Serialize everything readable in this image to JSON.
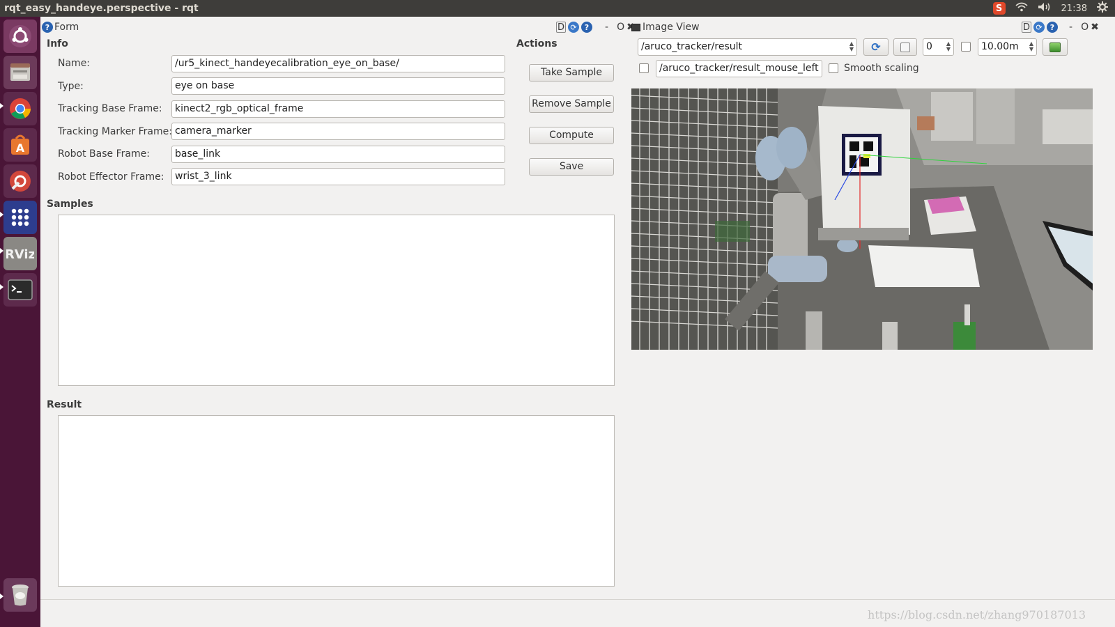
{
  "window": {
    "title": "rqt_easy_handeye.perspective - rqt"
  },
  "tray": {
    "ime_label": "S",
    "clock": "21:38"
  },
  "launcher": {
    "items": [
      "ubuntu-dash",
      "files",
      "chrome",
      "software-center",
      "system-settings",
      "app-grid",
      "rviz",
      "terminal",
      "trash"
    ]
  },
  "form_panel": {
    "title": "Form",
    "info_heading": "Info",
    "actions_heading": "Actions",
    "fields": [
      {
        "label": "Name:",
        "value": "/ur5_kinect_handeyecalibration_eye_on_base/"
      },
      {
        "label": "Type:",
        "value": "eye on base"
      },
      {
        "label": "Tracking Base Frame:",
        "value": "kinect2_rgb_optical_frame"
      },
      {
        "label": "Tracking Marker Frame:",
        "value": "camera_marker"
      },
      {
        "label": "Robot Base Frame:",
        "value": "base_link"
      },
      {
        "label": "Robot Effector Frame:",
        "value": "wrist_3_link"
      }
    ],
    "buttons": {
      "take_sample": "Take Sample",
      "remove_sample": "Remove Sample",
      "compute": "Compute",
      "save": "Save"
    },
    "samples_heading": "Samples",
    "result_heading": "Result"
  },
  "dock_tools": {
    "d": "D",
    "minimize": "-",
    "restore": "O",
    "close": "✖"
  },
  "image_view": {
    "title": "Image View",
    "topic": "/aruco_tracker/result",
    "spin_value": "0",
    "range_value": "10.00m",
    "mouse_topic": "/aruco_tracker/result_mouse_left",
    "smooth_label": "Smooth scaling"
  },
  "watermark": "https://blog.csdn.net/zhang970187013"
}
